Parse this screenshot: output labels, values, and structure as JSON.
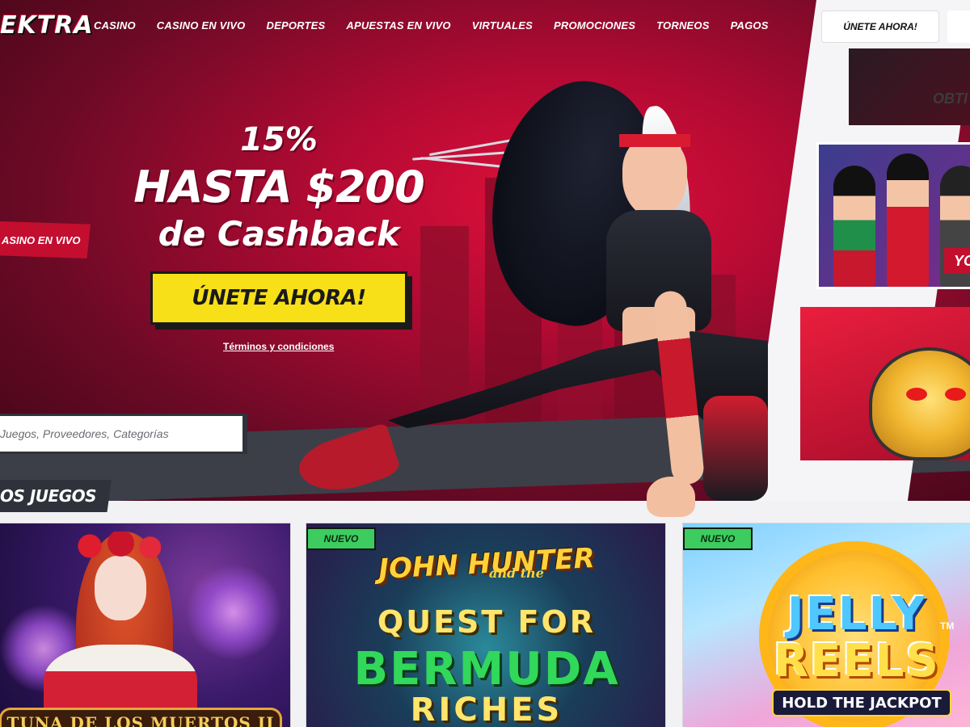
{
  "header": {
    "logo": "EKTRA",
    "nav": [
      "CASINO",
      "CASINO EN VIVO",
      "DEPORTES",
      "APUESTAS EN VIVO",
      "VIRTUALES",
      "PROMOCIONES",
      "TORNEOS",
      "PAGOS"
    ],
    "join_label": "ÚNETE AHORA!"
  },
  "hero": {
    "line1": "15%",
    "line2": "HASTA $200",
    "line3": "de Cashback",
    "cta_label": "ÚNETE AHORA!",
    "terms_label": "Términos y condiciones",
    "side_tag": "ASINO EN VIVO"
  },
  "right_thumbs": {
    "thumb_a_text": "OBTI",
    "thumb_b_text": "YO"
  },
  "search": {
    "placeholder": "Juegos, Proveedores, Categorías"
  },
  "section": {
    "title": "OS JUEGOS"
  },
  "games": [
    {
      "title": "TUNA DE LOS MUERTOS II",
      "badge": ""
    },
    {
      "badge": "NUEVO",
      "title_lines": [
        "JOHN HUNTER",
        "and the",
        "QUEST FOR",
        "BERMUDA",
        "RICHES"
      ]
    },
    {
      "badge": "NUEVO",
      "title_lines": [
        "JELLY",
        "REELS",
        "HOLD THE JACKPOT"
      ],
      "tm": "TM"
    }
  ],
  "colors": {
    "hero_red": "#c30e30",
    "cta_yellow": "#f7e018",
    "new_badge_green": "#3ccc5f",
    "dark_panel": "#2f323a"
  }
}
